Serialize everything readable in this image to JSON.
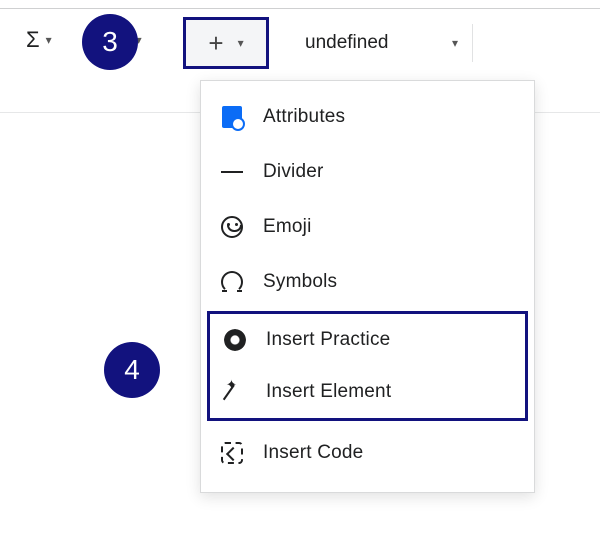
{
  "callouts": {
    "step3": "3",
    "step4": "4"
  },
  "toolbar": {
    "sigma": "Σ",
    "undefined_label": "undefined"
  },
  "menu": {
    "items": [
      {
        "label": "Attributes"
      },
      {
        "label": "Divider"
      },
      {
        "label": "Emoji"
      },
      {
        "label": "Symbols"
      }
    ],
    "highlighted": [
      {
        "label": "Insert Practice"
      },
      {
        "label": "Insert Element"
      }
    ],
    "after": [
      {
        "label": "Insert Code"
      }
    ]
  }
}
